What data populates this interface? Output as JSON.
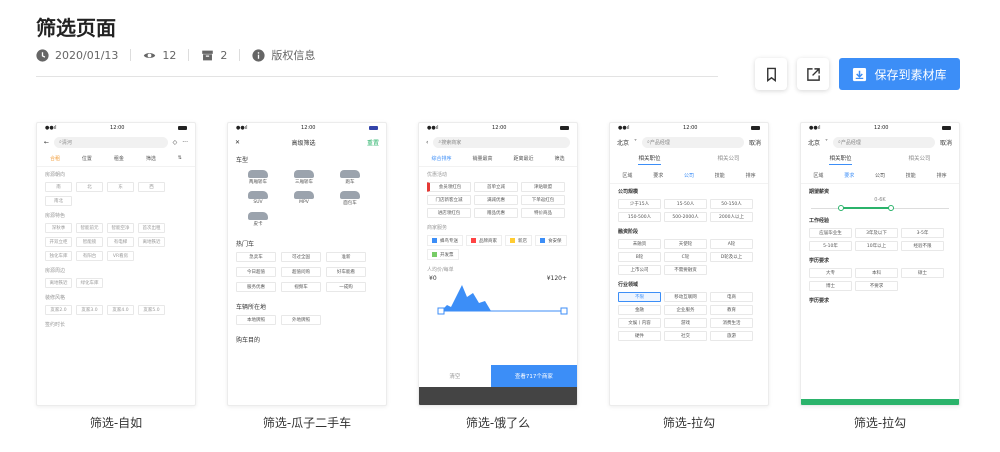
{
  "page": {
    "title": "筛选页面",
    "date": "2020/01/13",
    "views": "12",
    "collections": "2",
    "copyright": "版权信息",
    "save_label": "保存到素材库"
  },
  "colors": {
    "accent": "#3c8ef7",
    "text": "#333333",
    "muted": "#999999"
  },
  "cards": [
    {
      "caption": "筛选-自如",
      "time": "12:00",
      "search": "清河",
      "filters": [
        "合租",
        "位置",
        "租金",
        "筛选"
      ],
      "sections": [
        {
          "title": "房源朝向",
          "chips": [
            "南",
            "北",
            "东",
            "西",
            "南北"
          ]
        },
        {
          "title": "房源特色",
          "chips": [
            "深秋季",
            "智能前元",
            "智能空净",
            "首次出租",
            "开双立柜",
            "智能锁",
            "有电梯",
            "离地铁近",
            "独化车库",
            "有阳台",
            "VR看房"
          ]
        },
        {
          "title": "房源周边",
          "chips": [
            "离地铁近",
            "绿化车库"
          ]
        },
        {
          "title": "装修风格",
          "chips": [
            "友家2.0",
            "友家3.0",
            "友家4.0",
            "友家5.0"
          ]
        },
        {
          "title": "签约时长",
          "chips": []
        }
      ]
    },
    {
      "caption": "筛选-瓜子二手车",
      "time": "12:00",
      "nav_title": "高级筛选",
      "reset": "重置",
      "car_section": "车型",
      "cars": [
        "两厢轿车",
        "三厢轿车",
        "跑车",
        "SUV",
        "MPV",
        "面包车",
        "皮卡"
      ],
      "hot_section": "热门车",
      "hot_chips": [
        "急卖车",
        "可过全国",
        "准新",
        "今日超值",
        "超值问购",
        "好车能看",
        "服务优惠",
        "视频车",
        "一成购"
      ],
      "loc_section": "车辆所在地",
      "loc_chips": [
        "本地牌照",
        "外地牌照"
      ],
      "purpose_section": "购车目的"
    },
    {
      "caption": "筛选-饿了么",
      "time": "12:00",
      "search": "搜索商家",
      "sort_tabs": [
        "综合排序",
        "销量最高",
        "距离最近",
        "筛选"
      ],
      "sec1": "优惠活动",
      "sec1_chips": [
        "会员领红包",
        "首单立减",
        "津贴联盟",
        "门店新客立减",
        "满减优惠",
        "下单返红包",
        "进店领红包",
        "赠品优惠",
        "特价商品"
      ],
      "sec2": "商家服务",
      "sec2_opts": [
        "蜂鸟专送",
        "品牌商家",
        "新店",
        "食安保",
        "开发票"
      ],
      "sec3": "人均价/每单",
      "price_min": "¥0",
      "price_max": "¥120+",
      "clear": "清空",
      "confirm": "查看717个商家"
    },
    {
      "caption": "筛选-拉勾",
      "time": "12:00",
      "city": "北京",
      "search": "产品经理",
      "cancel": "取消",
      "tabs": [
        "相关职位",
        "相关公司"
      ],
      "filters": [
        "区域",
        "要求",
        "公司",
        "技能",
        "排序"
      ],
      "groups": [
        {
          "title": "公司规模",
          "chips": [
            "少于15人",
            "15-50人",
            "50-150人",
            "150-500人",
            "500-2000人",
            "2000人以上"
          ]
        },
        {
          "title": "融资阶段",
          "chips": [
            "未融资",
            "天使轮",
            "A轮",
            "B轮",
            "C轮",
            "D轮及以上",
            "上市公司",
            "不需要融资"
          ]
        },
        {
          "title": "行业领域",
          "chips": [
            "不限",
            "移动互联网",
            "电商",
            "金融",
            "企业服务",
            "教育",
            "文娱丨内容",
            "游戏",
            "消费生活",
            "硬件",
            "社交",
            "旅游"
          ]
        }
      ]
    },
    {
      "caption": "筛选-拉勾",
      "time": "12:00",
      "city": "北京",
      "search": "产品经理",
      "cancel": "取消",
      "tabs": [
        "相关职位",
        "相关公司"
      ],
      "filters": [
        "区域",
        "要求",
        "公司",
        "技能",
        "排序"
      ],
      "salary_title": "期望薪资",
      "salary_range": "0-6K",
      "exp_title": "工作经验",
      "exp_chips": [
        "应届毕业生",
        "3年及以下",
        "3-5年",
        "5-10年",
        "10年以上",
        "经验不限"
      ],
      "edu_title": "学历要求",
      "edu_chips": [
        "大专",
        "本科",
        "硕士",
        "博士",
        "不要求"
      ],
      "edu2_title": "学历要求"
    }
  ]
}
